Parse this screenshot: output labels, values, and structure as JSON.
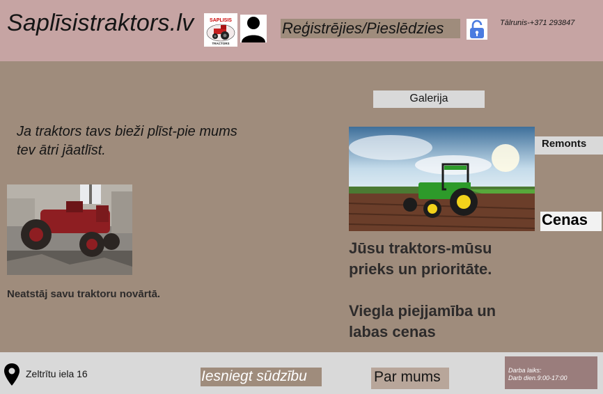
{
  "header": {
    "site_title": "Saplīsistraktors.lv",
    "logo_text_top": "SAPLISIS",
    "logo_text_bottom": "TRACTORS",
    "login_label": "Reģistrējies/Pieslēdzies",
    "phone": "Tālrunis-+371 293847"
  },
  "nav": {
    "gallery": "Galerija",
    "repair": "Remonts",
    "prices": "Cenas"
  },
  "main": {
    "slogan_line1": "Ja traktors tavs bieži plīst-pie mums",
    "slogan_line2": "tev ātri jāatlīst.",
    "neglect_text": "Neatstāj savu traktoru novārtā.",
    "headline1_line1": "Jūsu traktors-mūsu",
    "headline1_line2": "prieks un prioritāte.",
    "headline2_line1": "Viegla piejjamība un",
    "headline2_line2": "labas cenas"
  },
  "footer": {
    "address": "Zeltrītu iela 16",
    "complaint": "Iesniegt sūdzību",
    "about": "Par mums",
    "hours_title": "Darba laiks:",
    "hours_value": "Darb dien.9:00-17:00"
  },
  "colors": {
    "header_bg": "#c6a4a3",
    "page_bg": "#9f8c7c",
    "footer_bg": "#d9d9d9"
  },
  "icons": [
    "tractor-logo-icon",
    "user-icon",
    "lock-icon",
    "location-pin-icon"
  ]
}
